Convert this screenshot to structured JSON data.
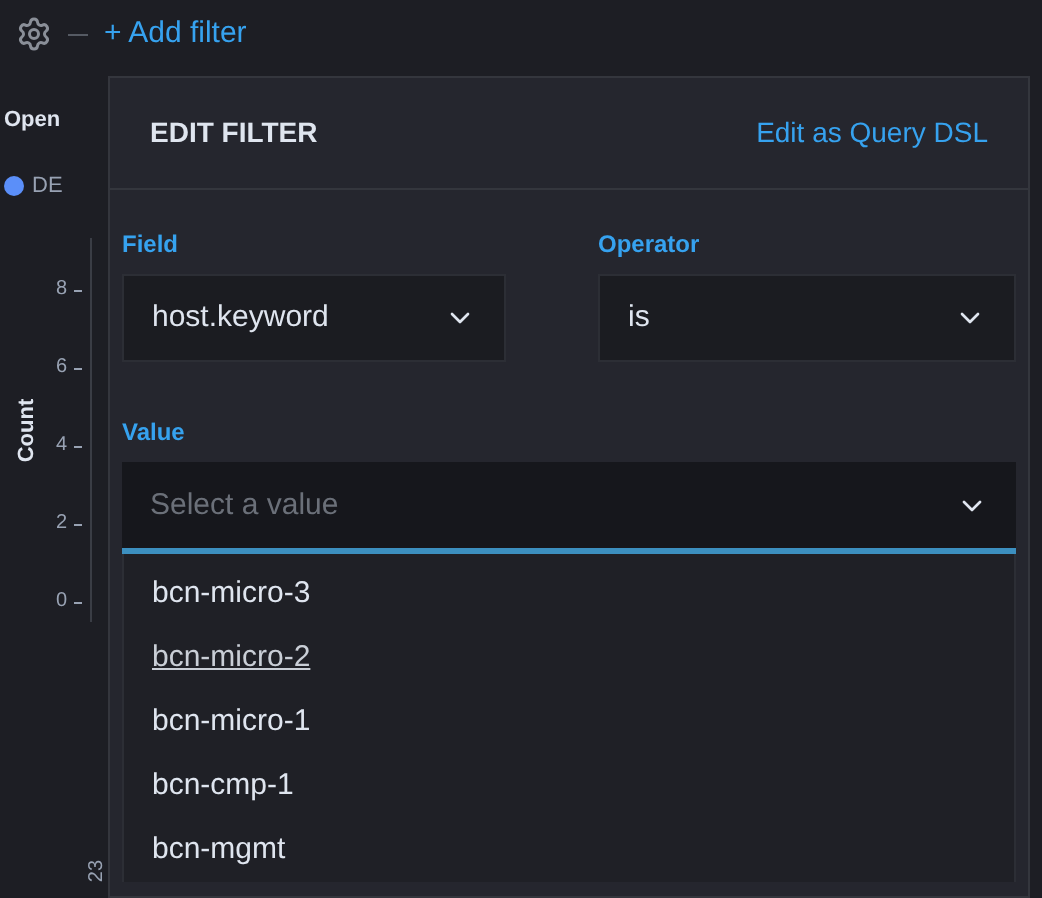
{
  "toolbar": {
    "add_filter": "+ Add filter"
  },
  "background": {
    "title": "Open",
    "legend": "DE",
    "y_ticks": [
      "8",
      "6",
      "4",
      "2",
      "0"
    ],
    "y_axis_label": "Count",
    "x_tick": "23"
  },
  "popover": {
    "title": "EDIT FILTER",
    "query_dsl_link": "Edit as Query DSL",
    "field": {
      "label": "Field",
      "value": "host.keyword"
    },
    "operator": {
      "label": "Operator",
      "value": "is"
    },
    "value": {
      "label": "Value",
      "placeholder": "Select a value"
    },
    "options": [
      {
        "label": "bcn-micro-3",
        "selected": false
      },
      {
        "label": "bcn-micro-2",
        "selected": true
      },
      {
        "label": "bcn-micro-1",
        "selected": false
      },
      {
        "label": "bcn-cmp-1",
        "selected": false
      },
      {
        "label": "bcn-mgmt",
        "selected": false
      }
    ]
  }
}
